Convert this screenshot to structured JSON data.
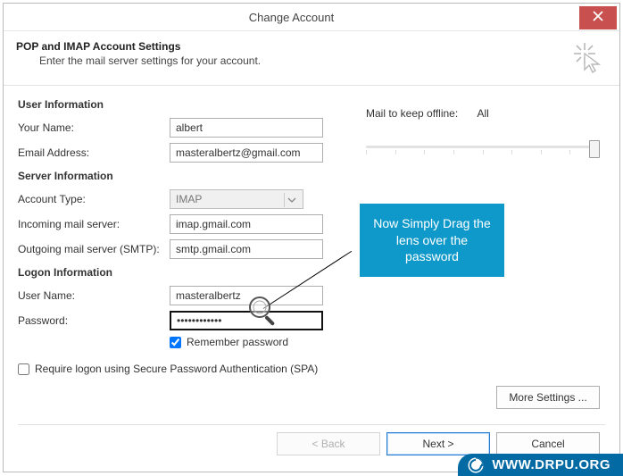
{
  "window": {
    "title": "Change Account"
  },
  "header": {
    "heading": "POP and IMAP Account Settings",
    "sub": "Enter the mail server settings for your account."
  },
  "sections": {
    "user": "User Information",
    "server": "Server Information",
    "logon": "Logon Information"
  },
  "labels": {
    "your_name": "Your Name:",
    "email": "Email Address:",
    "account_type": "Account Type:",
    "incoming": "Incoming mail server:",
    "outgoing": "Outgoing mail server (SMTP):",
    "username": "User Name:",
    "password": "Password:",
    "remember": "Remember password",
    "spa": "Require logon using Secure Password Authentication (SPA)",
    "mailkeep": "Mail to keep offline:",
    "mailkeep_val": "All"
  },
  "values": {
    "your_name": "albert",
    "email": "masteralbertz@gmail.com",
    "account_type": "IMAP",
    "incoming": "imap.gmail.com",
    "outgoing": "smtp.gmail.com",
    "username": "masteralbertz",
    "password": "************"
  },
  "buttons": {
    "more": "More Settings ...",
    "back": "< Back",
    "next": "Next >",
    "cancel": "Cancel"
  },
  "callout": "Now Simply Drag the lens over the password",
  "watermark": "WWW.DRPU.ORG"
}
